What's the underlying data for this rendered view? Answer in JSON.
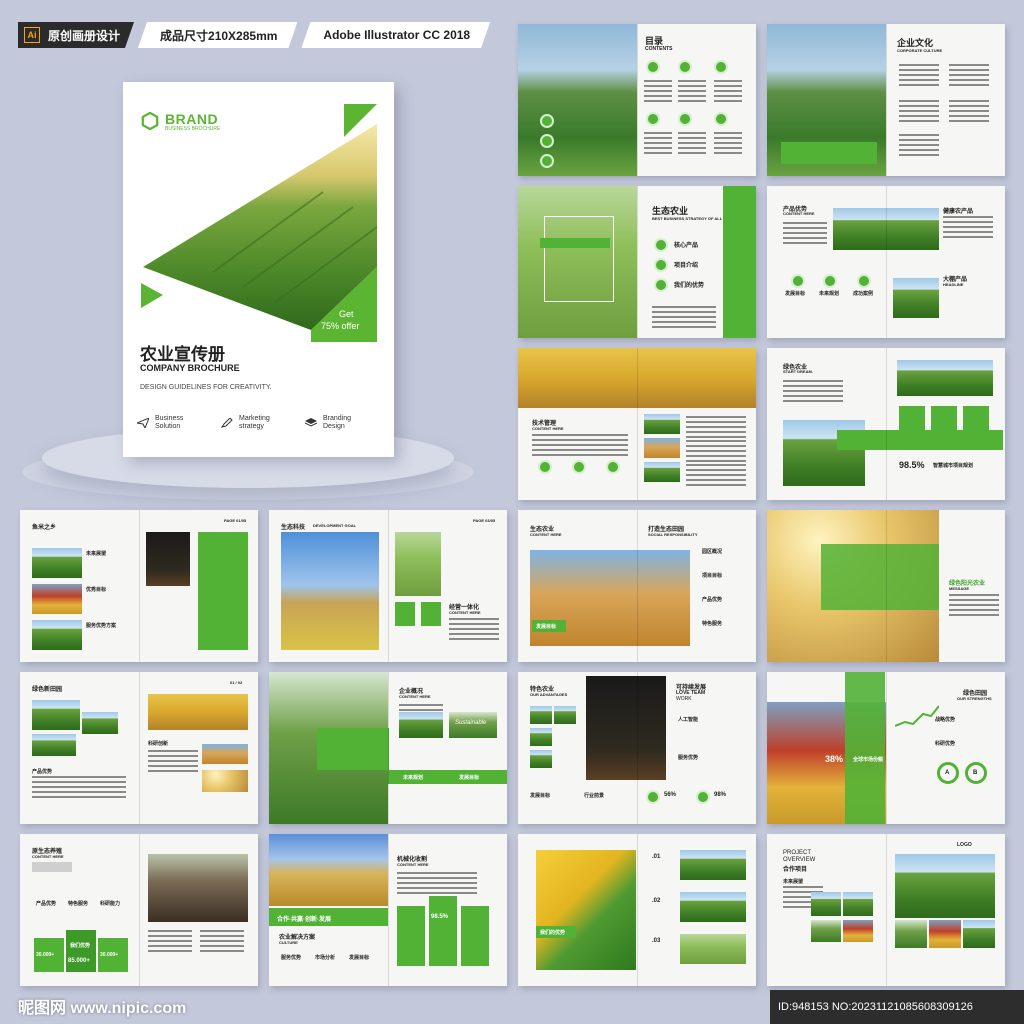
{
  "header": {
    "tag1": "原创画册设计",
    "tag2": "成品尺寸210X285mm",
    "tag3": "Adobe Illustrator CC 2018",
    "ai_label": "Ai"
  },
  "cover": {
    "brand": "BRAND",
    "brand_sub": "BUSINESS BROCHURE",
    "offer_line1": "Get",
    "offer_line2": "75% offer",
    "title_cn": "农业宣传册",
    "title_en": "COMPANY BROCHURE",
    "guide": "DESIGN GUIDELINES FOR CREATIVITY.",
    "items": [
      {
        "l1": "Business",
        "l2": "Solution",
        "icon": "paper-plane-icon"
      },
      {
        "l1": "Marketing",
        "l2": "strategy",
        "icon": "pen-icon"
      },
      {
        "l1": "Branding",
        "l2": "Design",
        "icon": "layers-icon"
      }
    ]
  },
  "pages": {
    "p1": {
      "title": "目录",
      "sub": "CONTENTS"
    },
    "p2": {
      "title": "企业文化",
      "sub": "CORPORATE CULTURE"
    },
    "p3": {
      "title": "生态农业",
      "sub": "BEST BUSINESS STRATEGY OF ALL",
      "items": [
        "核心产品",
        "项目介绍",
        "我们的优势"
      ]
    },
    "p4": {
      "title": "产品优势",
      "sub": "CONTENT HERE",
      "t2": "健康农产品",
      "t3": "大棚产品",
      "t3sub": "HEADLINE",
      "labels": [
        "发展目标",
        "未来规划",
        "成功案例"
      ]
    },
    "p5": {
      "title": "技术管理",
      "sub": "CONTENT HERE"
    },
    "p6": {
      "title": "绿色农业",
      "sub": "START DREAM.",
      "percent": "98.5%",
      "caption": "智慧城市项目规划"
    },
    "p7": {
      "title": "鱼米之乡",
      "items": [
        "未来展望",
        "优秀目标",
        "服务优势方案"
      ],
      "pagenum": "PAGE 01/05"
    },
    "p8": {
      "title": "生态科技",
      "sub": "DEVELOPMENT GOAL",
      "t2": "经营一体化",
      "t2sub": "CONTENT HERE",
      "pagenum": "PAGE 03/05"
    },
    "p9": {
      "title": "生态农业",
      "sub": "CONTENT HERE",
      "t2": "打造生态田园",
      "t2sub": "SOCIAL RESPONSIBILITY",
      "items": [
        "园区概况",
        "项目目标",
        "产品优势",
        "特色服务"
      ],
      "badge": "发展目标"
    },
    "p10": {
      "title": "绿色阳光农业",
      "sub": "MESSAGE"
    },
    "p11": {
      "title": "绿色新田园",
      "items": [
        "科研创新",
        "产品优势"
      ],
      "pagenum": "01 / 02"
    },
    "p12": {
      "title": "企业概况",
      "sub": "CONTENT HERE",
      "script": "Sustainable",
      "labels": [
        "未来规划",
        "发展目标"
      ]
    },
    "p13": {
      "title": "特色农业",
      "sub": "OUR ADVANTAGES",
      "t2": "可持续发展",
      "t2b": "LOVE TEAM",
      "t2c": "WORK",
      "items": [
        "人工智能",
        "服务优势"
      ],
      "p1": "56%",
      "p2": "98%",
      "bottom": [
        "发展目标",
        "行业前景"
      ]
    },
    "p14": {
      "title": "绿色田园",
      "sub": "OUR STRENGTHS",
      "percent": "38%",
      "caption": "全球市场份额",
      "labels": [
        "A",
        "B"
      ],
      "items": [
        "战略优势",
        "科研优势"
      ]
    },
    "p15": {
      "title": "原生态养殖",
      "sub": "CONTENT HERE",
      "items": [
        "产品优势",
        "特色服务",
        "科研能力"
      ],
      "n1": "30.000+",
      "n2": "85.000+",
      "n3": "30.000+",
      "mid": "我们优势"
    },
    "p16": {
      "title": "机械化收割",
      "sub": "CONTENT HERE",
      "slogan": "合作·共赢·创新·发展",
      "t2": "农业解决方案",
      "t2sub": "CULTURE",
      "percent": "98.5%",
      "labels": [
        "服务优势",
        "市场分析",
        "发展目标"
      ]
    },
    "p17": {
      "numbers": [
        ".01",
        ".02",
        ".03"
      ],
      "badge": "我们的优势"
    },
    "p18": {
      "logo": "LOGO",
      "title1": "PROJECT",
      "title2": "OVERVIEW",
      "title3": "合作项目",
      "item": "未来展望"
    }
  },
  "footer": {
    "left": "昵图网 www.nipic.com",
    "right": "ID:948153 NO:20231121085608309126"
  },
  "colors": {
    "accent": "#52b236",
    "background": "#c3c8da"
  }
}
